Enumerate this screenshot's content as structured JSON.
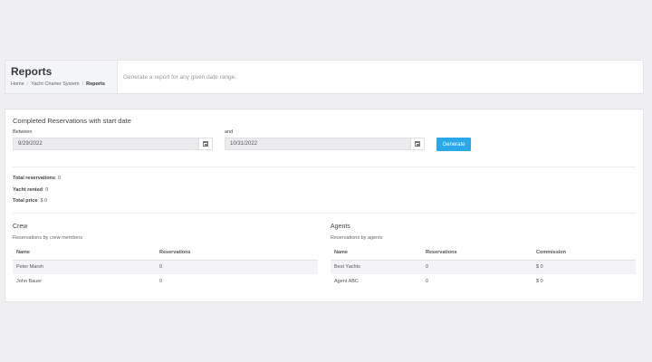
{
  "header": {
    "title": "Reports",
    "breadcrumb": [
      "Home",
      "Yacht Charter System",
      "Reports"
    ],
    "description": "Generate a report for any given date range."
  },
  "filter": {
    "section_title": "Completed Reservations with start date",
    "between_label": "Between",
    "and_label": "and",
    "start_date": "9/29/2022",
    "end_date": "10/31/2022",
    "generate_label": "Generate"
  },
  "stats": {
    "total_reservations_label": "Total reservations",
    "total_reservations": ": 0",
    "yacht_rented_label": "Yacht rented",
    "yacht_rented": ": 0",
    "total_price_label": "Total price",
    "total_price": ": $ 0"
  },
  "crew": {
    "title": "Crew",
    "subtitle": "Reservations by crew members",
    "columns": [
      "Name",
      "Reservations"
    ],
    "rows": [
      [
        "Peter Marsh",
        "0"
      ],
      [
        "John Bauer",
        "0"
      ]
    ]
  },
  "agents": {
    "title": "Agents",
    "subtitle": "Reservations by agents",
    "columns": [
      "Name",
      "Reservations",
      "Commission"
    ],
    "rows": [
      [
        "Best Yachts",
        "0",
        "$ 0"
      ],
      [
        "Agent ABC",
        "0",
        "$ 0"
      ]
    ]
  }
}
